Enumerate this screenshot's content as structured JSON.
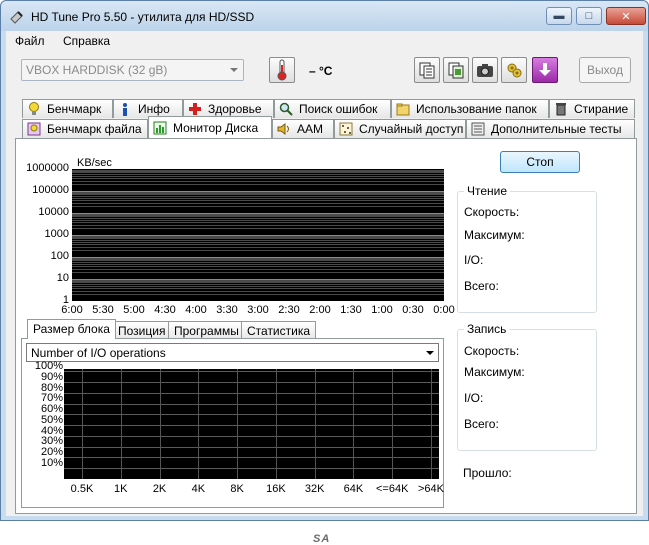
{
  "window": {
    "title": "HD Tune Pro 5.50 - утилита для HD/SSD",
    "min_glyph": "▬",
    "max_glyph": "□",
    "close_glyph": "✕"
  },
  "menu": [
    {
      "label": "Файл"
    },
    {
      "label": "Справка"
    }
  ],
  "toolbar": {
    "drive": "VBOX HARDDISK (32 gB)",
    "temperature": "– °C",
    "exit_label": "Выход",
    "icons": [
      "thermometer-icon",
      "copy-text-icon",
      "copy-screenshot-icon",
      "camera-icon",
      "options-icon",
      "save-icon"
    ]
  },
  "tabs_row1": [
    {
      "label": "Бенчмарк",
      "icon": "bulb-icon"
    },
    {
      "label": "Инфо",
      "icon": "info-icon"
    },
    {
      "label": "Здоровье",
      "icon": "health-cross-icon"
    },
    {
      "label": "Поиск ошибок",
      "icon": "magnifier-icon"
    },
    {
      "label": "Использование папок",
      "icon": "folder-icon"
    },
    {
      "label": "Стирание",
      "icon": "trash-icon"
    }
  ],
  "tabs_row2": [
    {
      "label": "Бенчмарк файла",
      "icon": "file-bulb-icon"
    },
    {
      "label": "Монитор Диска",
      "icon": "monitor-chart-icon",
      "active": true
    },
    {
      "label": "AAM",
      "icon": "speaker-icon"
    },
    {
      "label": "Случайный доступ",
      "icon": "random-access-icon"
    },
    {
      "label": "Дополнительные  тесты",
      "icon": "extra-tests-icon"
    }
  ],
  "monitor": {
    "stop_label": "Стоп",
    "read_group": {
      "title": "Чтение",
      "fields": [
        "Скорость:",
        "Максимум:",
        "I/O:",
        "Всего:"
      ]
    },
    "write_group": {
      "title": "Запись",
      "fields": [
        "Скорость:",
        "Максимум:",
        "I/O:",
        "Всего:"
      ]
    },
    "elapsed_label": "Прошло:"
  },
  "subtabs": [
    {
      "label": "Размер блока",
      "active": true
    },
    {
      "label": "Позиция"
    },
    {
      "label": "Программы"
    },
    {
      "label": "Статистика"
    }
  ],
  "block_combo": {
    "selected": "Number of I/O operations"
  },
  "chart_data": [
    {
      "type": "line",
      "ylabel": "KB/sec",
      "yscale": "log",
      "yticks": [
        "1000000",
        "100000",
        "10000",
        "1000",
        "100",
        "10",
        "1"
      ],
      "xticks": [
        "6:00",
        "5:30",
        "5:00",
        "4:30",
        "4:00",
        "3:30",
        "3:00",
        "2:30",
        "2:00",
        "1:30",
        "1:00",
        "0:30",
        "0:00"
      ],
      "series": [],
      "grid": true
    },
    {
      "type": "bar",
      "yticks": [
        "100%",
        "90%",
        "80%",
        "70%",
        "60%",
        "50%",
        "40%",
        "30%",
        "20%",
        "10%"
      ],
      "categories": [
        "0.5K",
        "1K",
        "2K",
        "4K",
        "8K",
        "16K",
        "32K",
        "64K",
        "<=64K",
        ">64K"
      ],
      "values": [],
      "grid": true
    }
  ],
  "watermark": "SA"
}
